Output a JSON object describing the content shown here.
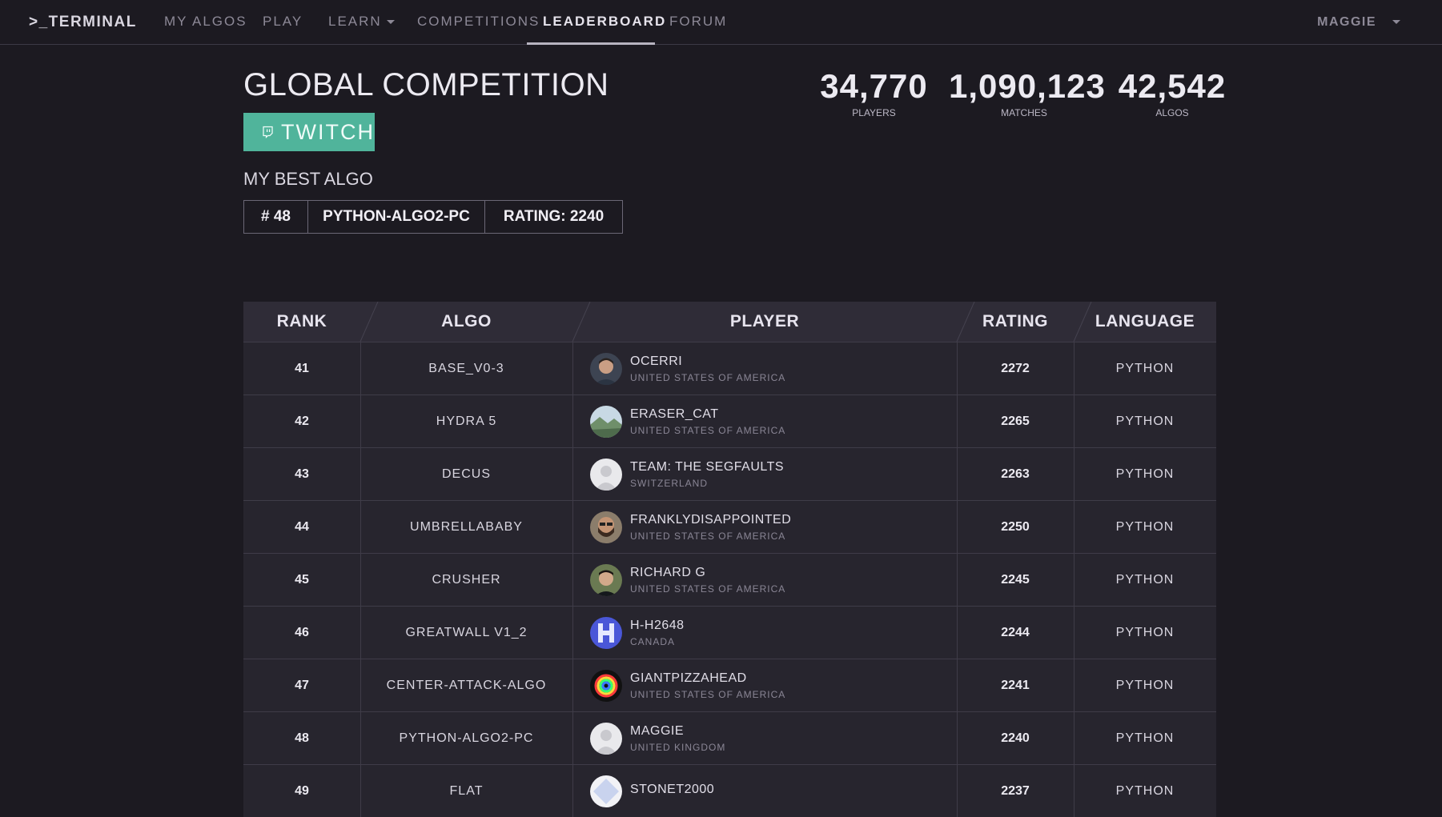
{
  "nav": {
    "logo": ">_TERMINAL",
    "items": [
      {
        "label": "MY ALGOS"
      },
      {
        "label": "PLAY"
      },
      {
        "label": "LEARN"
      },
      {
        "label": "COMPETITIONS"
      },
      {
        "label": "LEADERBOARD",
        "active": true
      },
      {
        "label": "FORUM"
      }
    ],
    "user": "MAGGIE"
  },
  "header": {
    "title": "GLOBAL COMPETITION",
    "twitch_label": "TWITCH",
    "best_label": "MY BEST ALGO",
    "best": {
      "rank": "# 48",
      "algo": "PYTHON-ALGO2-PC",
      "rating": "RATING: 2240"
    }
  },
  "stats": [
    {
      "value": "34,770",
      "label": "PLAYERS"
    },
    {
      "value": "1,090,123",
      "label": "MATCHES"
    },
    {
      "value": "42,542",
      "label": "ALGOS"
    }
  ],
  "table": {
    "columns": [
      "RANK",
      "ALGO",
      "PLAYER",
      "RATING",
      "LANGUAGE"
    ],
    "rows": [
      {
        "rank": "41",
        "algo": "BASE_V0-3",
        "player": "OCERRI",
        "country": "UNITED STATES OF AMERICA",
        "rating": "2272",
        "language": "PYTHON",
        "avatar": "photo-dark"
      },
      {
        "rank": "42",
        "algo": "HYDRA 5",
        "player": "ERASER_CAT",
        "country": "UNITED STATES OF AMERICA",
        "rating": "2265",
        "language": "PYTHON",
        "avatar": "landscape"
      },
      {
        "rank": "43",
        "algo": "DECUS",
        "player": "TEAM: THE SEGFAULTS",
        "country": "SWITZERLAND",
        "rating": "2263",
        "language": "PYTHON",
        "avatar": "default"
      },
      {
        "rank": "44",
        "algo": "UMBRELLABABY",
        "player": "FRANKLYDISAPPOINTED",
        "country": "UNITED STATES OF AMERICA",
        "rating": "2250",
        "language": "PYTHON",
        "avatar": "photo-beard"
      },
      {
        "rank": "45",
        "algo": "CRUSHER",
        "player": "RICHARD G",
        "country": "UNITED STATES OF AMERICA",
        "rating": "2245",
        "language": "PYTHON",
        "avatar": "photo-glasses"
      },
      {
        "rank": "46",
        "algo": "GREATWALL V1_2",
        "player": "H-H2648",
        "country": "CANADA",
        "rating": "2244",
        "language": "PYTHON",
        "avatar": "blue-h"
      },
      {
        "rank": "47",
        "algo": "CENTER-ATTACK-ALGO",
        "player": "GIANTPIZZAHEAD",
        "country": "UNITED STATES OF AMERICA",
        "rating": "2241",
        "language": "PYTHON",
        "avatar": "rainbow"
      },
      {
        "rank": "48",
        "algo": "PYTHON-ALGO2-PC",
        "player": "MAGGIE",
        "country": "UNITED KINGDOM",
        "rating": "2240",
        "language": "PYTHON",
        "avatar": "default"
      },
      {
        "rank": "49",
        "algo": "FLAT",
        "player": "STONET2000",
        "country": "",
        "rating": "2237",
        "language": "PYTHON",
        "avatar": "diamond"
      }
    ]
  },
  "colors": {
    "background": "#1c1a21",
    "accent_twitch": "#50b49b",
    "table_row": "#27252e",
    "table_header": "#2f2c37"
  }
}
